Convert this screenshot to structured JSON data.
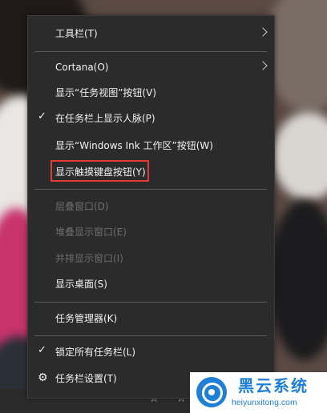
{
  "menu": {
    "items": [
      {
        "label": "工具栏(T)"
      },
      {
        "label": "Cortana(O)"
      },
      {
        "label": "显示“任务视图”按钮(V)"
      },
      {
        "label": "在任务栏上显示人脉(P)"
      },
      {
        "label": "显示“Windows Ink 工作区”按钮(W)"
      },
      {
        "label": "显示触摸键盘按钮(Y)"
      },
      {
        "label": "层叠窗口(D)"
      },
      {
        "label": "堆叠显示窗口(E)"
      },
      {
        "label": "并排显示窗口(I)"
      },
      {
        "label": "显示桌面(S)"
      },
      {
        "label": "任务管理器(K)"
      },
      {
        "label": "锁定所有任务栏(L)"
      },
      {
        "label": "任务栏设置(T)"
      }
    ]
  },
  "glyphs": {
    "check": "✓",
    "gear": "⚙",
    "star": "☆"
  },
  "watermark": {
    "title": "黑云系统",
    "url": "heiyunxitong.com"
  },
  "colors": {
    "menu_bg": "#2b2b2b",
    "highlight_border": "#e33c36",
    "watermark_blue": "#1d7fd7"
  }
}
